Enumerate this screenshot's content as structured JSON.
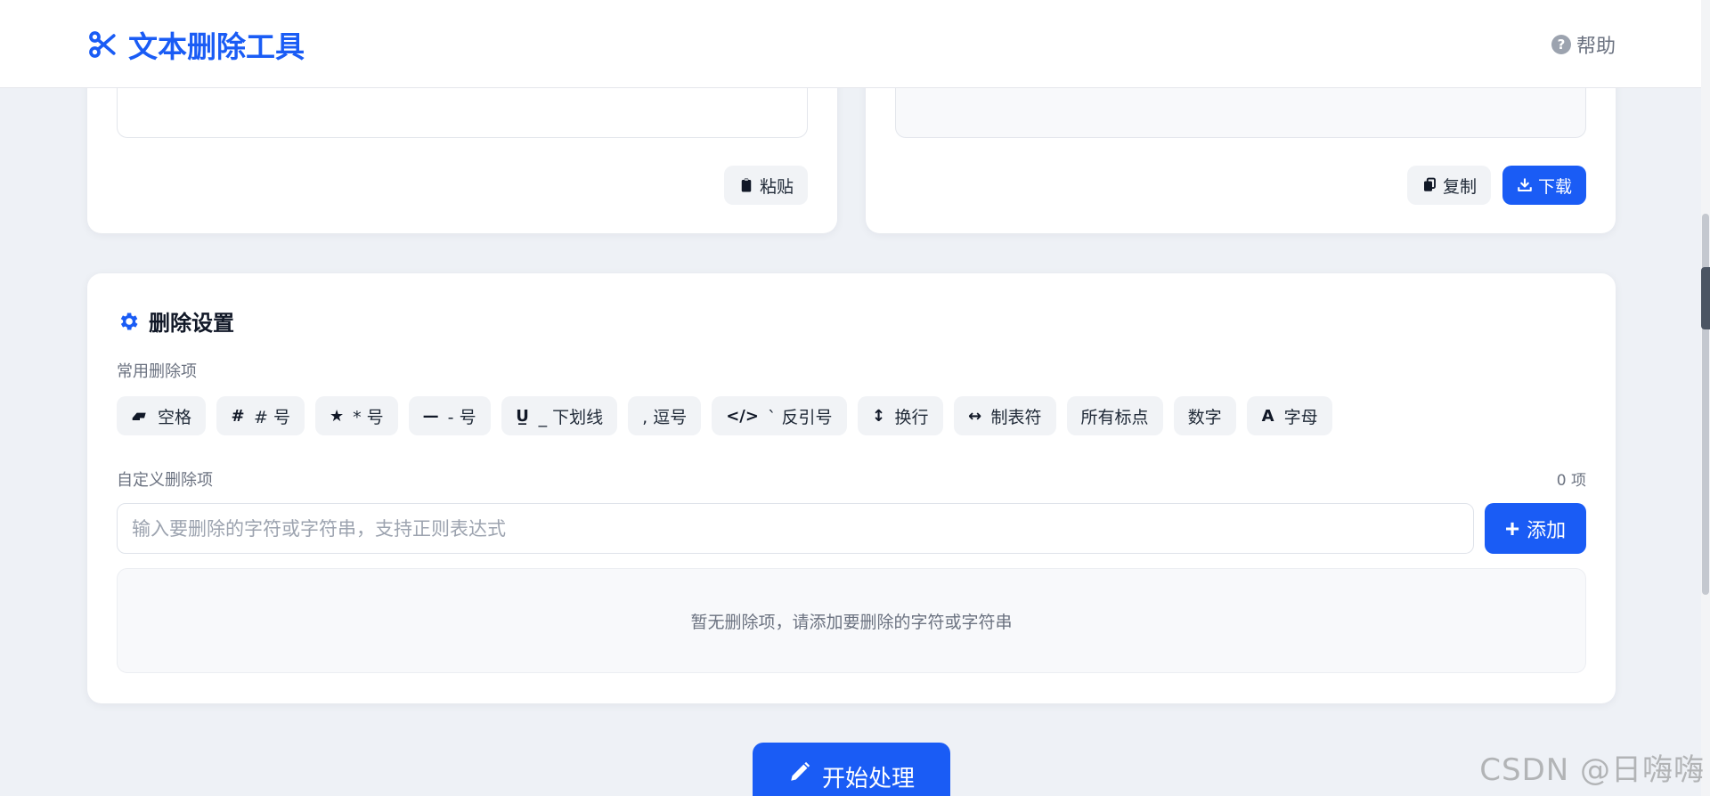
{
  "header": {
    "title": "文本删除工具",
    "help_label": "帮助",
    "help_symbol": "?"
  },
  "input_card": {
    "paste_label": "粘贴"
  },
  "output_card": {
    "copy_label": "复制",
    "download_label": "下载"
  },
  "settings": {
    "title": "删除设置",
    "common_label": "常用删除项",
    "common_items": [
      {
        "icon": "eraser-icon",
        "symbol": "",
        "label": "空格"
      },
      {
        "icon": "hash-icon",
        "symbol": "#",
        "label": "# 号"
      },
      {
        "icon": "star-icon",
        "symbol": "★",
        "label": "* 号"
      },
      {
        "icon": "minus-icon",
        "symbol": "—",
        "label": "- 号"
      },
      {
        "icon": "underline-icon",
        "symbol": "U̲",
        "label": "_ 下划线"
      },
      {
        "icon": "",
        "symbol": "",
        "label": ", 逗号"
      },
      {
        "icon": "code-icon",
        "symbol": "</>",
        "label": "` 反引号"
      },
      {
        "icon": "vertical-arrows-icon",
        "symbol": "↕",
        "label": "换行"
      },
      {
        "icon": "horizontal-arrows-icon",
        "symbol": "↔",
        "label": "制表符"
      },
      {
        "icon": "",
        "symbol": "",
        "label": "所有标点"
      },
      {
        "icon": "",
        "symbol": "",
        "label": "数字"
      },
      {
        "icon": "letter-a-icon",
        "symbol": "A",
        "label": "字母"
      }
    ],
    "custom_label": "自定义删除项",
    "custom_count": "0 项",
    "custom_placeholder": "输入要删除的字符或字符串，支持正则表达式",
    "custom_value": "",
    "add_label": "添加",
    "add_symbol": "+",
    "empty_text": "暂无删除项，请添加要删除的字符或字符串"
  },
  "start_label": "开始处理",
  "watermark": "CSDN @日嗨嗨",
  "colors": {
    "primary": "#1a5cf5",
    "background": "#eef1f6",
    "chip_bg": "#f1f3f6"
  }
}
